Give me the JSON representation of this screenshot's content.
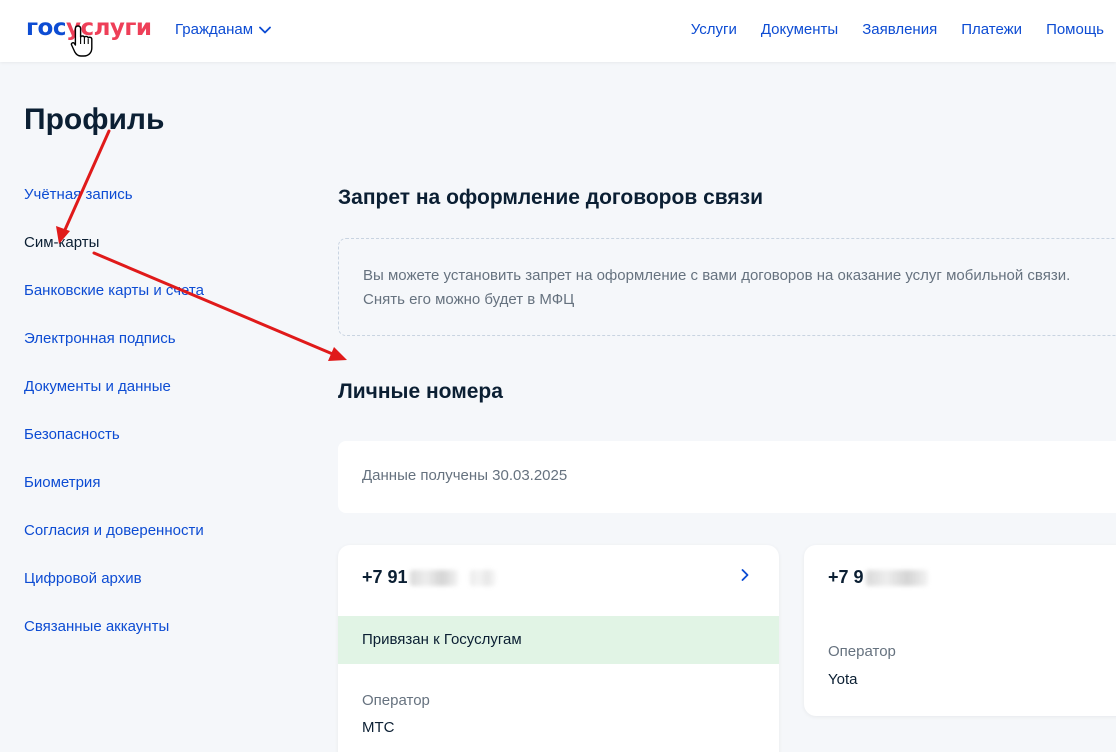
{
  "header": {
    "logo_part1": "гос",
    "logo_part2": "услуги",
    "role_select": "Гражданам",
    "nav": [
      "Услуги",
      "Документы",
      "Заявления",
      "Платежи",
      "Помощь"
    ]
  },
  "sidebar": {
    "title": "Профиль",
    "items": [
      "Учётная запись",
      "Сим-карты",
      "Банковские карты и счета",
      "Электронная подпись",
      "Документы и данные",
      "Безопасность",
      "Биометрия",
      "Согласия и доверенности",
      "Цифровой архив",
      "Связанные аккаунты"
    ],
    "active_index": 1
  },
  "main": {
    "ban_title": "Запрет на оформление договоров связи",
    "ban_text_line1": "Вы можете установить запрет на оформление с вами договоров на оказание услуг мобильной связи.",
    "ban_text_line2": "Снять его можно будет в МФЦ",
    "numbers_title": "Личные номера",
    "data_received": "Данные получены 30.03.2025",
    "cards": [
      {
        "phone_visible": "+7 91",
        "linked": "Привязан к Госуслугам",
        "operator_label": "Оператор",
        "operator": "МТС"
      },
      {
        "phone_visible": "+7 9",
        "operator_label": "Оператор",
        "operator": "Yota"
      }
    ]
  },
  "colors": {
    "accent": "#0d4cd3",
    "brand_red": "#ee3f58",
    "annotation_arrow": "#e01a1a",
    "linked_bg": "#e1f4e5"
  },
  "icons": [
    "chevron-down-icon",
    "chevron-right-icon",
    "hand-cursor-icon"
  ]
}
